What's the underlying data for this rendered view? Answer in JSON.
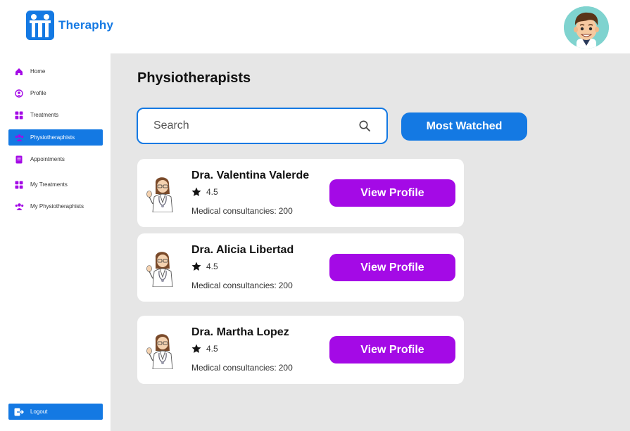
{
  "app": {
    "name": "Theraphy",
    "brand_color": "#1479e3",
    "accent_color": "#a40ae6"
  },
  "header": {
    "logo_icon": "theraphy-logo-icon",
    "avatar_icon": "user-avatar-icon"
  },
  "sidebar": {
    "items": [
      {
        "label": "Home",
        "icon": "home-icon",
        "active": false
      },
      {
        "label": "Profile",
        "icon": "profile-icon",
        "active": false
      },
      {
        "label": "Treatments",
        "icon": "grid-icon",
        "active": false
      },
      {
        "label": "Physiotheraphists",
        "icon": "people-icon",
        "active": true
      },
      {
        "label": "Appointments",
        "icon": "document-icon",
        "active": false
      },
      {
        "label": "My Treatments",
        "icon": "grid-icon",
        "active": false
      },
      {
        "label": "My Physiotheraphists",
        "icon": "people-icon",
        "active": false
      }
    ],
    "logout_label": "Logout"
  },
  "main": {
    "title": "Physiotherapists",
    "search": {
      "placeholder": "Search",
      "value": ""
    },
    "most_watched_label": "Most Watched",
    "therapists": [
      {
        "name": "Dra. Valentina Valerde",
        "rating": "4.5",
        "consult_label": "Medical consultancies:",
        "consult_count": "200",
        "button": "View Profile"
      },
      {
        "name": "Dra. Alicia Libertad",
        "rating": "4.5",
        "consult_label": "Medical consultancies:",
        "consult_count": "200",
        "button": "View Profile"
      },
      {
        "name": "Dra. Martha Lopez",
        "rating": "4.5",
        "consult_label": "Medical consultancies:",
        "consult_count": "200",
        "button": "View Profile"
      }
    ]
  }
}
